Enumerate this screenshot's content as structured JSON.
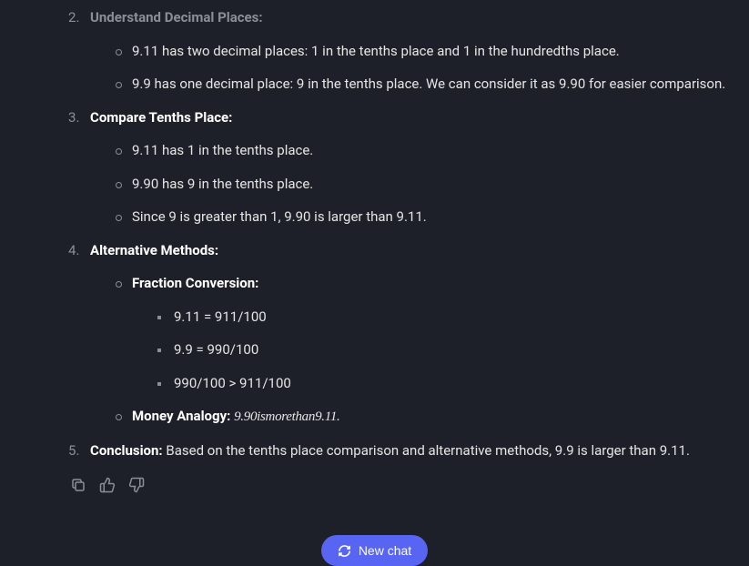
{
  "steps": [
    {
      "title": "Understand Decimal Places:",
      "items": [
        "9.11 has two decimal places: 1 in the tenths place and 1 in the hundredths place.",
        "9.9 has one decimal place: 9 in the tenths place. We can consider it as 9.90 for easier comparison."
      ]
    },
    {
      "title": "Compare Tenths Place:",
      "items": [
        "9.11 has 1 in the tenths place.",
        "9.90 has 9 in the tenths place.",
        "Since 9 is greater than 1, 9.90 is larger than 9.11."
      ]
    },
    {
      "title": "Alternative Methods:",
      "fraction_title": "Fraction Conversion:",
      "fractions": [
        "9.11 = 911/100",
        "9.9 = 990/100",
        "990/100 > 911/100"
      ],
      "money_title": "Money Analogy:",
      "money_math": "9.90ismorethan9.11."
    },
    {
      "title": "Conclusion:",
      "text": "Based on the tenths place comparison and alternative methods, 9.9 is larger than 9.11."
    }
  ],
  "new_chat_label": "New chat"
}
